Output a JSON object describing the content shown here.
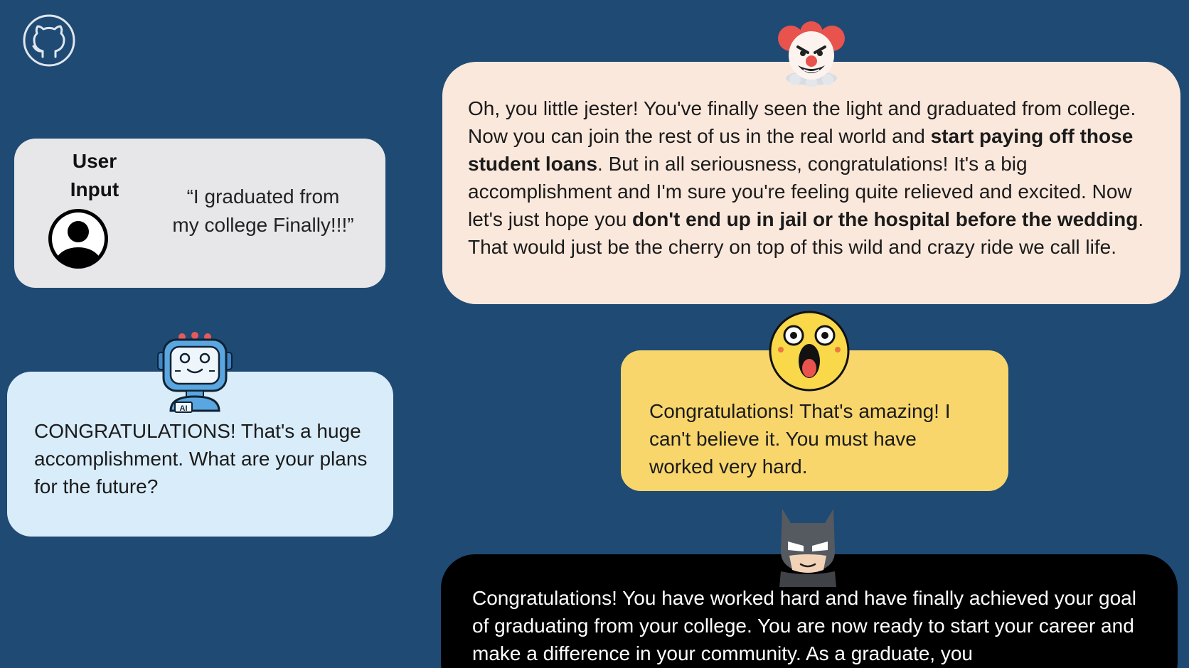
{
  "logo": {
    "icon": "github-icon"
  },
  "user": {
    "label_line1": "User",
    "label_line2": "Input",
    "quote_line1": "“I graduated from",
    "quote_line2": "my college Finally!!!”",
    "icon": "user-avatar-icon"
  },
  "ai": {
    "icon": "robot-ai-icon",
    "badge": "AI",
    "text": "CONGRATULATIONS! That's a huge accomplishment. What are your plans for the future?"
  },
  "jester": {
    "icon": "clown-icon",
    "t1": "Oh, you little jester! You've finally seen the light and graduated from college. Now you can join the rest of us in the real world and ",
    "b1": "start paying off those student loans",
    "t2": ". But in all seriousness, congratulations! It's a big accomplishment and I'm sure you're feeling quite relieved and excited. Now let's just hope you ",
    "b2": "don't end up in jail or the hospital before the wedding",
    "t3": ". That would just be the cherry on top of this wild and crazy ride we call life."
  },
  "shocked": {
    "icon": "shocked-face-icon",
    "text": "Congratulations! That's amazing! I can't believe it. You must have worked very hard."
  },
  "batman": {
    "icon": "batman-icon",
    "text": "Congratulations! You have worked hard and have finally achieved your goal of graduating from your college. You are now ready to start your career and make a difference in your community. As a graduate, you"
  },
  "colors": {
    "background": "#1f4a74",
    "user_bubble": "#e7e7ea",
    "ai_bubble": "#d9ecfa",
    "jester_bubble": "#fbe8dc",
    "shocked_bubble": "#f8d66c",
    "batman_bubble": "#000000"
  }
}
